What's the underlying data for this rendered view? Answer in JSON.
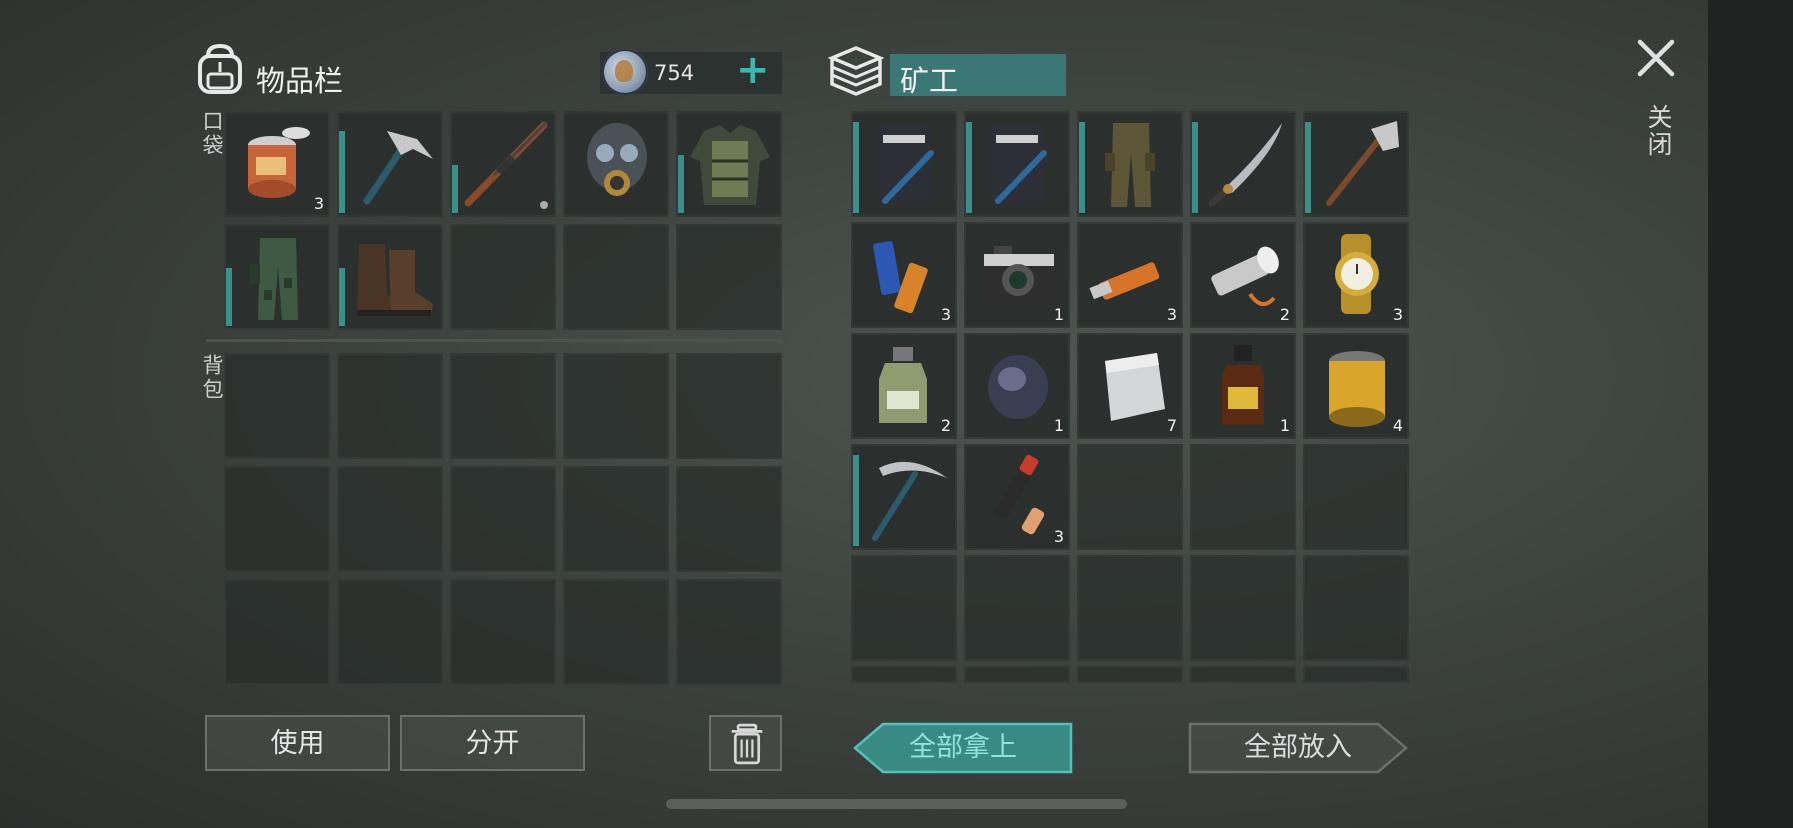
{
  "inventory": {
    "title": "物品栏",
    "coins": "754",
    "plus": "+",
    "pocket_label": "口袋",
    "backpack_label": "背包",
    "pocket_slots": [
      {
        "icon": "food-can-icon",
        "qty": "3",
        "dur": 0
      },
      {
        "icon": "hammer-icon",
        "qty": "",
        "dur": 0.85
      },
      {
        "icon": "hunting-rifle-icon",
        "qty": "",
        "dur": 0.5,
        "dot": true
      },
      {
        "icon": "gas-mask-icon",
        "qty": "",
        "dur": 0
      },
      {
        "icon": "body-armor-icon",
        "qty": "",
        "dur": 0.6
      },
      {
        "icon": "camo-pants-icon",
        "qty": "",
        "dur": 0.6
      },
      {
        "icon": "leather-boots-icon",
        "qty": "",
        "dur": 0.6
      },
      {
        "icon": "",
        "qty": ""
      },
      {
        "icon": "",
        "qty": ""
      },
      {
        "icon": "",
        "qty": ""
      }
    ]
  },
  "loot": {
    "title": "矿工",
    "slots": [
      {
        "icon": "riot-shield-icon",
        "qty": "",
        "dur": 0.95
      },
      {
        "icon": "riot-shield-icon",
        "qty": "",
        "dur": 0.95
      },
      {
        "icon": "cargo-pants-icon",
        "qty": "",
        "dur": 0.95
      },
      {
        "icon": "machete-icon",
        "qty": "",
        "dur": 0.95
      },
      {
        "icon": "axe-icon",
        "qty": "",
        "dur": 0.95
      },
      {
        "icon": "batteries-icon",
        "qty": "3"
      },
      {
        "icon": "camera-icon",
        "qty": "1"
      },
      {
        "icon": "usb-drive-icon",
        "qty": "3"
      },
      {
        "icon": "flashlight-icon",
        "qty": "2"
      },
      {
        "icon": "gold-watch-icon",
        "qty": "3"
      },
      {
        "icon": "chemical-bottle-icon",
        "qty": "2"
      },
      {
        "icon": "lens-icon",
        "qty": "1"
      },
      {
        "icon": "metal-plate-icon",
        "qty": "7"
      },
      {
        "icon": "iodine-bottle-icon",
        "qty": "1"
      },
      {
        "icon": "air-filter-icon",
        "qty": "4"
      },
      {
        "icon": "pickaxe-icon",
        "qty": "",
        "dur": 0.95
      },
      {
        "icon": "flare-icon",
        "qty": "3"
      }
    ]
  },
  "buttons": {
    "use": "使用",
    "split": "分开",
    "take_all": "全部拿上",
    "put_all": "全部放入",
    "close": "关闭"
  },
  "colors": {
    "accent": "#3fb6ad",
    "durability": "#3a8f88",
    "title_highlight": "#3b7875"
  }
}
